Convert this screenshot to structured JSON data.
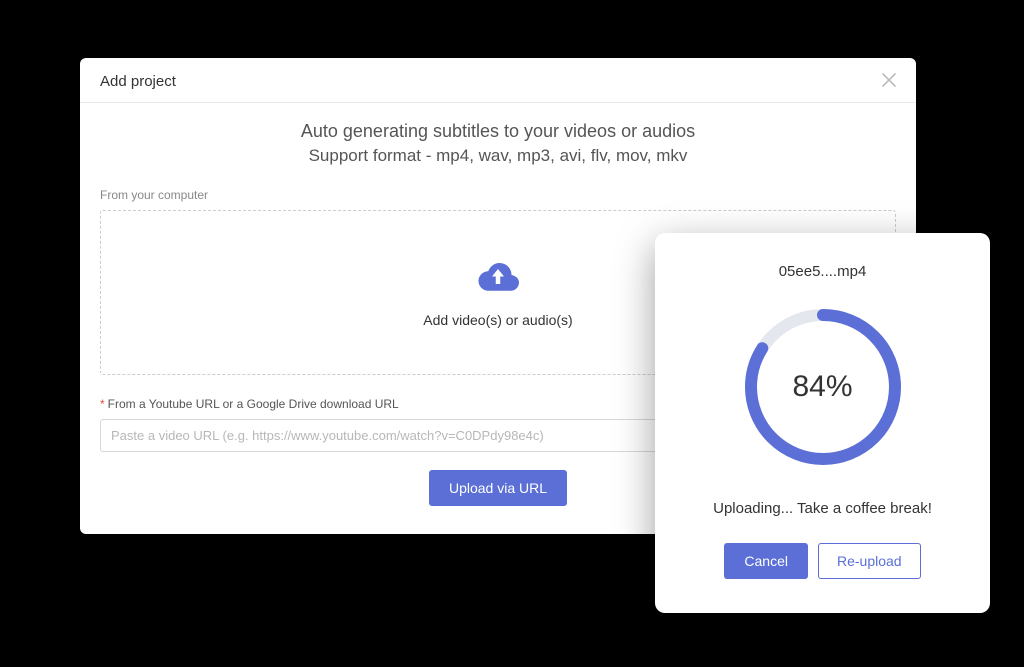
{
  "modal": {
    "title": "Add project",
    "headline": "Auto generating subtitles to your videos or audios",
    "subhead": "Support format - mp4, wav, mp3, avi, flv, mov, mkv",
    "from_label": "From your computer",
    "dropzone_text": "Add video(s) or audio(s)",
    "url_label": "From a Youtube URL or a Google Drive download URL",
    "url_placeholder": "Paste a video URL (e.g. https://www.youtube.com/watch?v=C0DPdy98e4c)",
    "upload_btn": "Upload via URL"
  },
  "progress": {
    "filename": "05ee5....mp4",
    "percent": 84,
    "percent_label": "84%",
    "status": "Uploading... Take a coffee break!",
    "cancel": "Cancel",
    "reupload": "Re-upload"
  }
}
